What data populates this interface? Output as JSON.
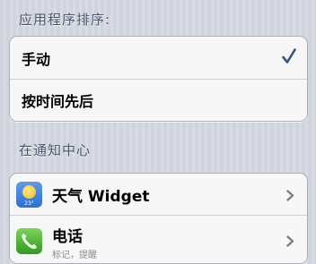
{
  "sort_section": {
    "header": "应用程序排序:",
    "options": [
      {
        "label": "手动",
        "selected": true
      },
      {
        "label": "按时间先后",
        "selected": false
      }
    ]
  },
  "notification_section": {
    "header": "在通知中心",
    "items": [
      {
        "label": "天气 Widget",
        "icon": "weather-icon",
        "icon_text": "23°"
      },
      {
        "label": "电话",
        "icon": "phone-icon",
        "subtitle": "标记，提醒"
      }
    ]
  },
  "colors": {
    "checkmark": "#385487",
    "chevron": "#7f7f7f",
    "header_text": "#4c566c"
  }
}
